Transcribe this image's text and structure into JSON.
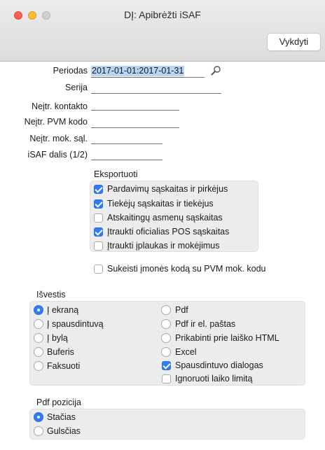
{
  "window": {
    "title": "DĮ: Apibrėžti iSAF"
  },
  "toolbar": {
    "run_label": "Vykdyti"
  },
  "form": {
    "periodas": {
      "label": "Periodas",
      "value": "2017-01-01:2017-01-31"
    },
    "serija": {
      "label": "Serija",
      "value": ""
    },
    "kontakto": {
      "label": "Neįtr. kontakto",
      "value": ""
    },
    "pvm": {
      "label": "Neįtr. PVM kodo",
      "value": ""
    },
    "mok": {
      "label": "Neįtr. mok. sąl.",
      "value": ""
    },
    "dalis": {
      "label": "iSAF dalis (1/2)",
      "value": ""
    }
  },
  "eksportuoti": {
    "title": "Eksportuoti",
    "items": [
      {
        "label": "Pardavimų sąskaitas ir pirkėjus",
        "checked": true
      },
      {
        "label": "Tiekėjų sąskaitas ir tiekėjus",
        "checked": true
      },
      {
        "label": "Atskaitingų asmenų sąskaitas",
        "checked": false
      },
      {
        "label": "Įtraukti oficialias POS sąskaitas",
        "checked": true
      },
      {
        "label": "Įtraukti įplaukas ir mokėjimus",
        "checked": false
      }
    ]
  },
  "swap": {
    "label": "Sukeisti įmonės kodą su PVM mok. kodu",
    "checked": false
  },
  "isvestis": {
    "title": "Išvestis",
    "left": [
      {
        "label": "Į ekraną",
        "selected": true
      },
      {
        "label": "Į spausdintuvą",
        "selected": false
      },
      {
        "label": "Į bylą",
        "selected": false
      },
      {
        "label": "Buferis",
        "selected": false
      },
      {
        "label": "Faksuoti",
        "selected": false
      }
    ],
    "right": [
      {
        "label": "Pdf",
        "selected": false
      },
      {
        "label": "Pdf ir el. paštas",
        "selected": false
      },
      {
        "label": "Prikabinti prie laiško HTML",
        "selected": false
      },
      {
        "label": "Excel",
        "selected": false
      }
    ],
    "checks": [
      {
        "label": "Spausdintuvo dialogas",
        "checked": true
      },
      {
        "label": "Ignoruoti laiko limitą",
        "checked": false
      }
    ]
  },
  "pdf": {
    "title": "Pdf pozicija",
    "options": [
      {
        "label": "Stačias",
        "selected": true
      },
      {
        "label": "Gulsčias",
        "selected": false
      }
    ]
  },
  "colors": {
    "accent": "#2f7cf6",
    "selection": "#b7d5f7",
    "group_bg": "#ececec"
  },
  "icons": {
    "search": "magnifier-icon"
  }
}
